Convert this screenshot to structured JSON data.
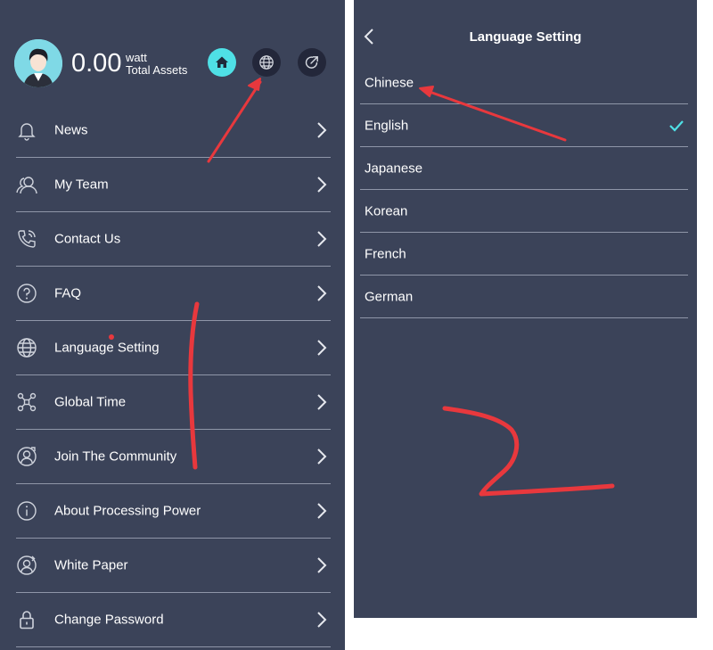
{
  "account": {
    "assets_value": "0.00",
    "assets_unit": "watt",
    "assets_label": "Total Assets"
  },
  "header_icons": [
    "home-icon",
    "globe-icon",
    "share-icon"
  ],
  "colors": {
    "panel_bg": "#3b4359",
    "accent": "#4fe0e6",
    "divider": "#8f96a8",
    "annotation": "#e8383d"
  },
  "menu": {
    "items": [
      {
        "label": "News",
        "icon": "bell-icon"
      },
      {
        "label": "My Team",
        "icon": "team-icon"
      },
      {
        "label": "Contact Us",
        "icon": "phone-icon"
      },
      {
        "label": "FAQ",
        "icon": "question-icon"
      },
      {
        "label": "Language Setting",
        "icon": "globe-icon"
      },
      {
        "label": "Global Time",
        "icon": "network-icon"
      },
      {
        "label": "Join The Community",
        "icon": "community-icon"
      },
      {
        "label": "About Processing Power",
        "icon": "info-icon"
      },
      {
        "label": "White Paper",
        "icon": "paper-icon"
      },
      {
        "label": "Change Password",
        "icon": "lock-icon"
      }
    ]
  },
  "language_setting": {
    "title": "Language Setting",
    "selected": "English",
    "languages": [
      "Chinese",
      "English",
      "Japanese",
      "Korean",
      "French",
      "German"
    ]
  }
}
